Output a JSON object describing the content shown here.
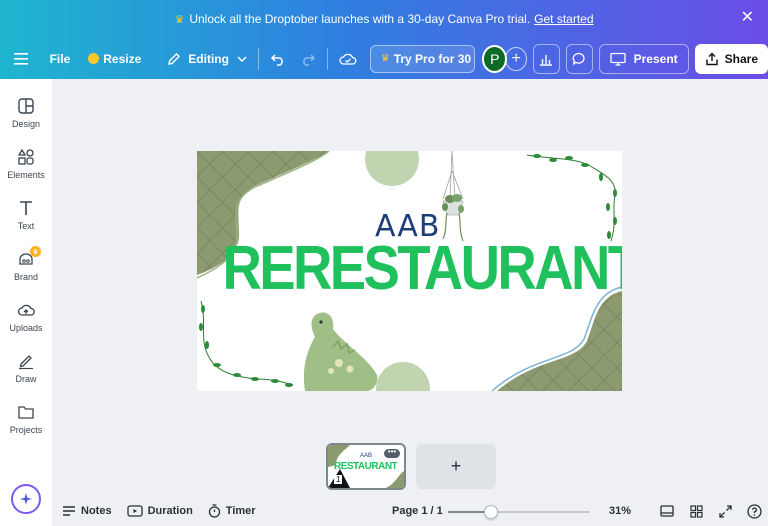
{
  "banner": {
    "text": "Unlock all the Droptober launches with a 30-day Canva Pro trial.",
    "cta": "Get started"
  },
  "toolbar": {
    "file": "File",
    "resize": "Resize",
    "editing": "Editing",
    "try_pro": "Try Pro for 30 ...",
    "avatar_initial": "P",
    "present": "Present",
    "share": "Share"
  },
  "sidebar": {
    "items": [
      {
        "label": "Design",
        "icon": "design-icon"
      },
      {
        "label": "Elements",
        "icon": "elements-icon"
      },
      {
        "label": "Text",
        "icon": "text-icon"
      },
      {
        "label": "Brand",
        "icon": "brand-icon"
      },
      {
        "label": "Uploads",
        "icon": "uploads-icon"
      },
      {
        "label": "Draw",
        "icon": "draw-icon"
      },
      {
        "label": "Projects",
        "icon": "projects-icon"
      }
    ]
  },
  "design": {
    "subtitle": "AAB",
    "title": "RERESTAURANT",
    "accent_color": "#20c15d",
    "pattern_color": "#8c9a70"
  },
  "pages": {
    "thumb_subtitle": "AAB",
    "thumb_title": "RESTAURANT",
    "page_number": "1",
    "more": "•••"
  },
  "bottombar": {
    "notes": "Notes",
    "duration": "Duration",
    "timer": "Timer",
    "page_indicator": "Page 1 / 1",
    "zoom": "31%",
    "zoom_fraction": 0.31
  }
}
